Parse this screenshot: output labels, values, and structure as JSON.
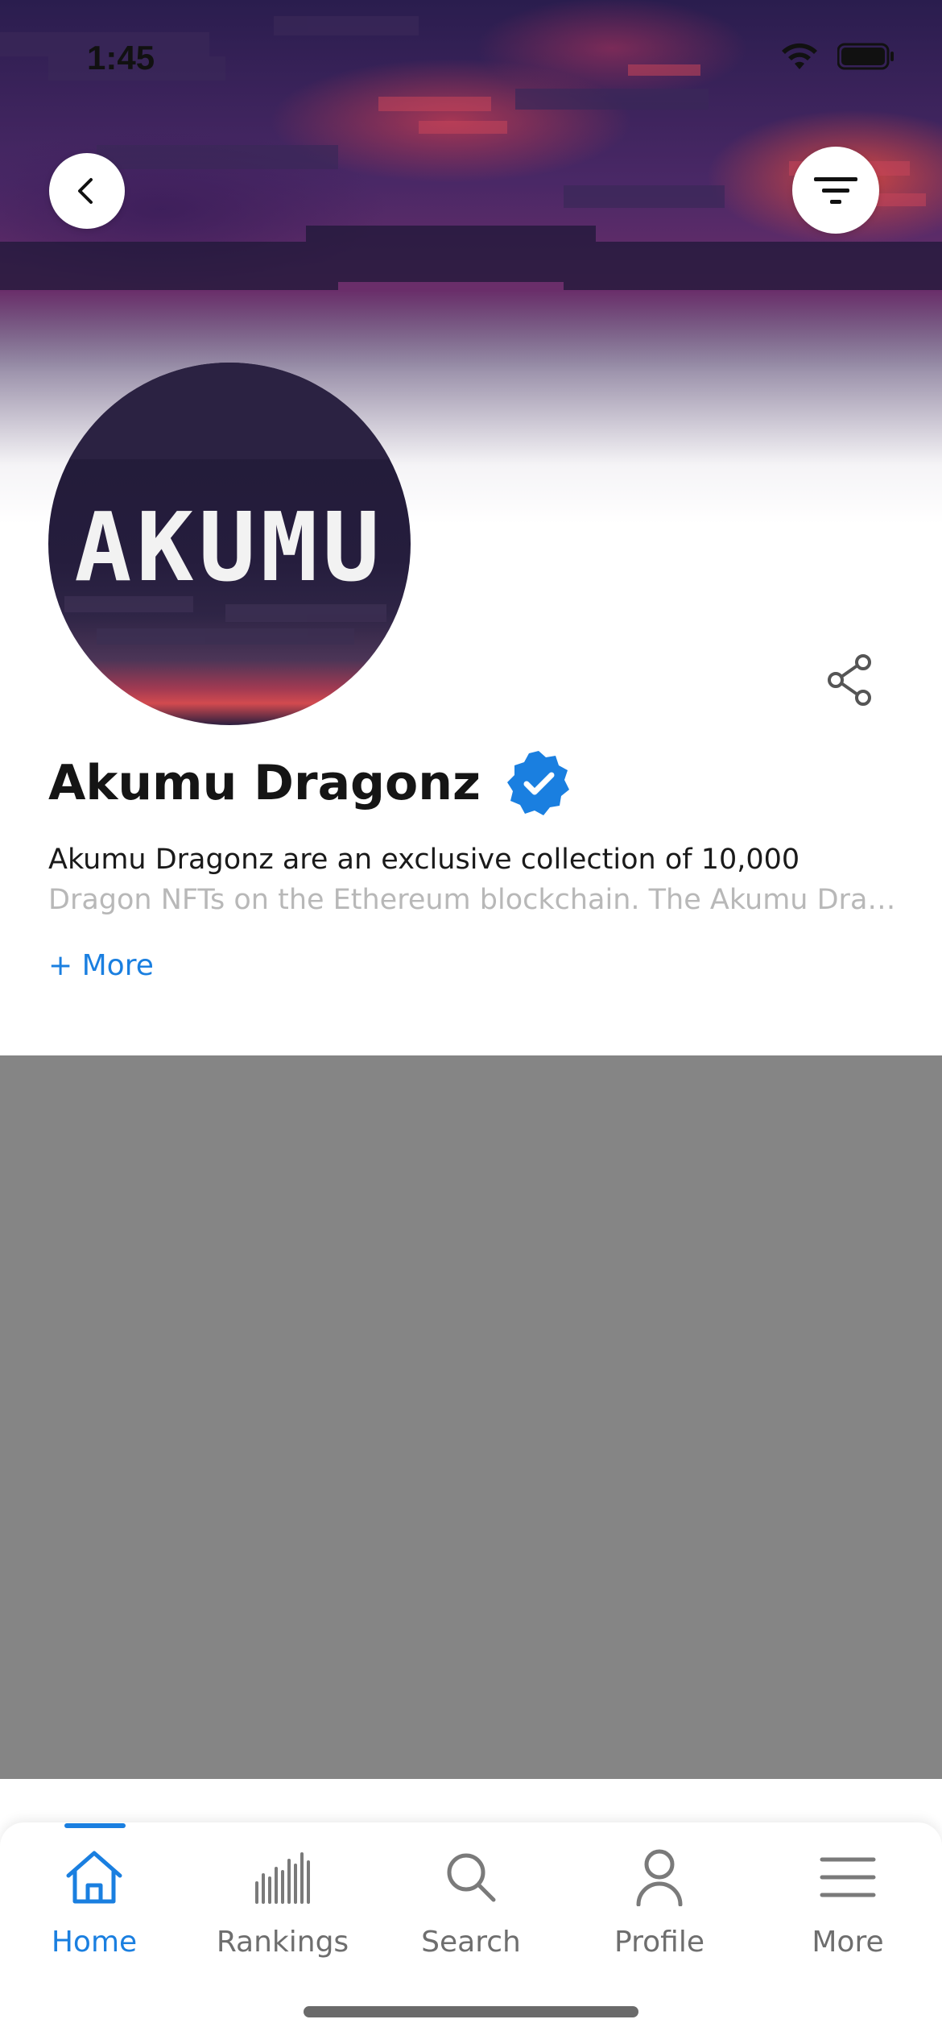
{
  "status_bar": {
    "time": "1:45"
  },
  "header": {
    "back_icon": "chevron-left-icon",
    "filter_icon": "filter-icon"
  },
  "collection": {
    "avatar_text": "AKUMU",
    "name": "Akumu Dragonz",
    "verified": true,
    "description_line_1": "Akumu Dragonz are an exclusive collection of 10,000",
    "description_line_2": "Dragon NFTs on the Ethereum blockchain. The Akumu Dragonz are a…",
    "more_label": "+ More",
    "share_icon": "share-icon"
  },
  "tab_bar": {
    "tabs": [
      {
        "label": "Home",
        "icon": "home-icon",
        "active": true
      },
      {
        "label": "Rankings",
        "icon": "bar-chart-icon",
        "active": false
      },
      {
        "label": "Search",
        "icon": "search-icon",
        "active": false
      },
      {
        "label": "Profile",
        "icon": "user-icon",
        "active": false
      },
      {
        "label": "More",
        "icon": "menu-icon",
        "active": false
      }
    ]
  },
  "colors": {
    "accent": "#1a7fe0",
    "verified_badge": "#1a7fe0",
    "content_placeholder": "#858585",
    "inactive_tab": "#6e6e6e"
  }
}
